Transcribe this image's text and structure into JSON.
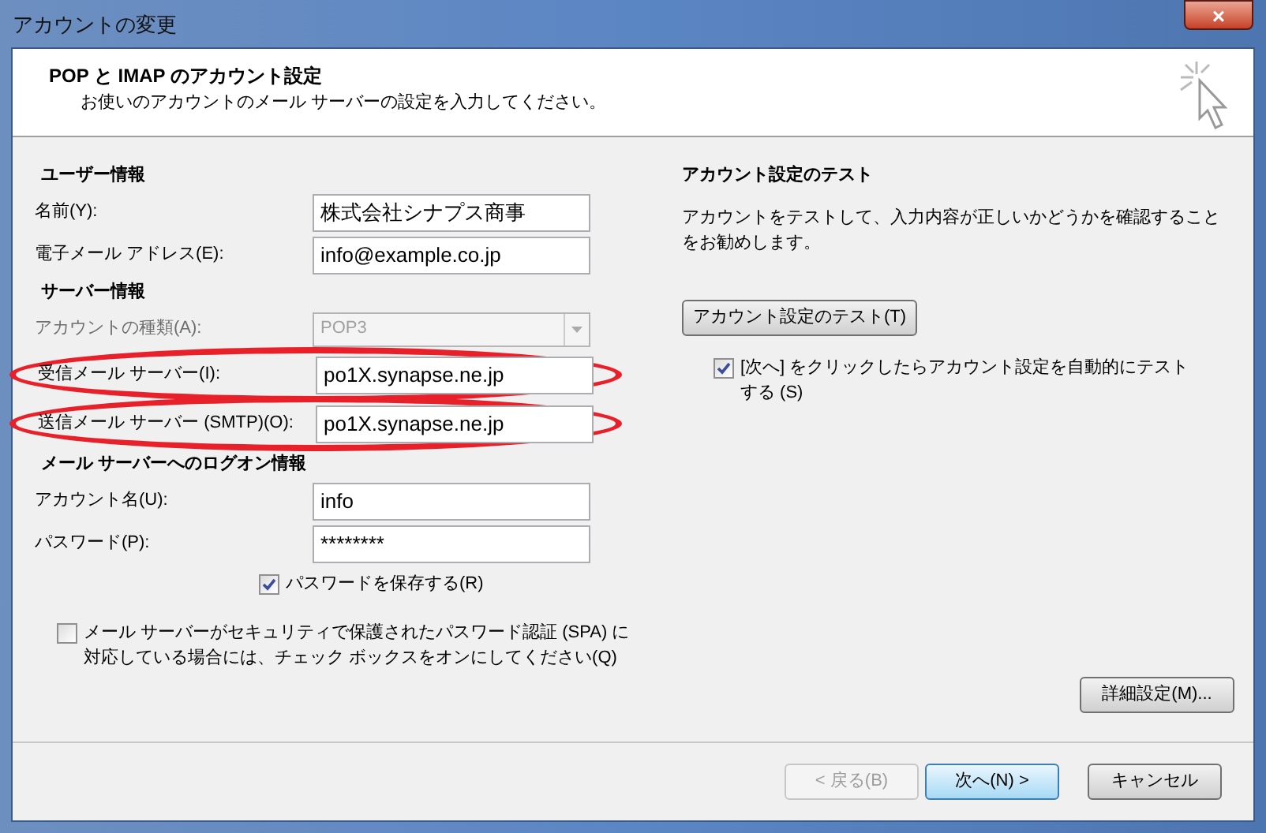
{
  "window": {
    "title": "アカウントの変更",
    "close": "×"
  },
  "header": {
    "title": "POP と IMAP のアカウント設定",
    "subtitle": "お使いのアカウントのメール サーバーの設定を入力してください。"
  },
  "left": {
    "sections": [
      {
        "heading": "ユーザー情報",
        "fields": [
          {
            "kind": "text",
            "label": "名前(Y):",
            "value": "株式会社シナプス商事",
            "highlighted": false,
            "disabled": false
          },
          {
            "kind": "text",
            "label": "電子メール アドレス(E):",
            "value": "info@example.co.jp",
            "highlighted": false,
            "disabled": false
          }
        ]
      },
      {
        "heading": "サーバー情報",
        "fields": [
          {
            "kind": "select",
            "label": "アカウントの種類(A):",
            "value": "POP3",
            "highlighted": false,
            "disabled": true
          },
          {
            "kind": "text",
            "label": "受信メール サーバー(I):",
            "value": "po1X.synapse.ne.jp",
            "highlighted": true,
            "disabled": false
          },
          {
            "kind": "text",
            "label": "送信メール サーバー (SMTP)(O):",
            "value": "po1X.synapse.ne.jp",
            "highlighted": true,
            "disabled": false
          }
        ]
      },
      {
        "heading": "メール サーバーへのログオン情報",
        "fields": [
          {
            "kind": "text",
            "label": "アカウント名(U):",
            "value": "info",
            "highlighted": false,
            "disabled": false
          },
          {
            "kind": "text",
            "label": "パスワード(P):",
            "value": "********",
            "highlighted": false,
            "disabled": false
          }
        ]
      }
    ],
    "save_password": {
      "label": "パスワードを保存する(R)",
      "checked": true
    },
    "spa": {
      "label": "メール サーバーがセキュリティで保護されたパスワード認証 (SPA) に対応している場合には、チェック ボックスをオンにしてください(Q)",
      "checked": false
    }
  },
  "right": {
    "heading": "アカウント設定のテスト",
    "description": "アカウントをテストして、入力内容が正しいかどうかを確認することをお勧めします。",
    "test_button": "アカウント設定のテスト(T)",
    "auto_test": {
      "label": "[次へ] をクリックしたらアカウント設定を自動的にテストする (S)",
      "checked": true
    },
    "advanced_button": "詳細設定(M)..."
  },
  "buttons": [
    {
      "label": "< 戻る(B)",
      "disabled": true,
      "default": false
    },
    {
      "label": "次へ(N) >",
      "disabled": false,
      "default": true
    },
    {
      "label": "キャンセル",
      "disabled": false,
      "default": false
    }
  ]
}
